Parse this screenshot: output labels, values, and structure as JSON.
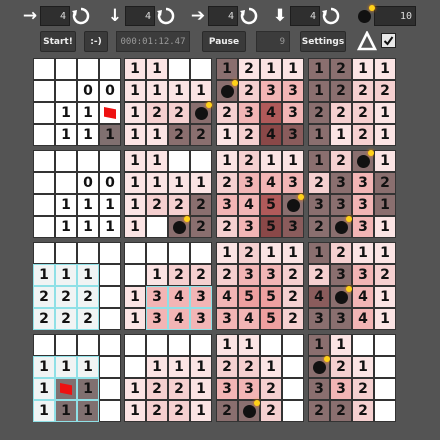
{
  "toolbar": {
    "controls": [
      {
        "arrow": "→",
        "arrow_icon": "arrow-right-icon",
        "value": "4"
      },
      {
        "arrow": "↓",
        "arrow_icon": "arrow-down-icon",
        "value": "4"
      },
      {
        "arrow": "➔",
        "arrow_icon": "bold-arrow-right-icon",
        "value": "4"
      },
      {
        "arrow": "⬇",
        "arrow_icon": "bold-arrow-down-icon",
        "value": "4"
      }
    ],
    "bomb_count": "10",
    "start_label": "Start!",
    "face_label": ":-)",
    "timer": "000:01:12.47",
    "pause_label": "Pause",
    "flags_left": "9",
    "settings_label": "Settings",
    "delta_label": "Δ",
    "checkbox_checked": true
  },
  "colors": {
    "bg": "#545454",
    "flag": "#ee1111",
    "highlight": "#8fe0e6"
  },
  "boards": [
    {
      "id": "0-0",
      "cells": [
        [
          "",
          "",
          "",
          ""
        ],
        [
          "",
          "",
          "0",
          "0"
        ],
        [
          "",
          "1",
          "1",
          "F"
        ],
        [
          "",
          "1",
          "1",
          "1"
        ]
      ],
      "shades": [
        [
          "#ffffff",
          "#ffffff",
          "#ffffff",
          "#ffffff"
        ],
        [
          "#ffffff",
          "#ffffff",
          "#ffffff",
          "#ffffff"
        ],
        [
          "#ffffff",
          "#ffffff",
          "#ffffff",
          "#ffffff"
        ],
        [
          "#ffffff",
          "#ffffff",
          "#ffffff",
          "#807070"
        ]
      ]
    },
    {
      "id": "0-1",
      "cells": [
        [
          "1",
          "1",
          "",
          ""
        ],
        [
          "1",
          "1",
          "1",
          "1"
        ],
        [
          "1",
          "2",
          "2",
          "B"
        ],
        [
          "1",
          "1",
          "2",
          "2"
        ]
      ],
      "shades": [
        [
          "#fbe4e4",
          "#fbe4e4",
          "#ffffff",
          "#ffffff"
        ],
        [
          "#fbe4e4",
          "#fbe4e4",
          "#fbe4e4",
          "#fbe4e4"
        ],
        [
          "#fbe4e4",
          "#f5d0d0",
          "#f5d0d0",
          "#8a6f6f"
        ],
        [
          "#fbe4e4",
          "#fbe4e4",
          "#8a6f6f",
          "#8a6f6f"
        ]
      ]
    },
    {
      "id": "0-2",
      "cells": [
        [
          "1",
          "2",
          "1",
          "1"
        ],
        [
          "B",
          "2",
          "3",
          "3"
        ],
        [
          "2",
          "3",
          "4",
          "3"
        ],
        [
          "1",
          "2",
          "4",
          "3"
        ]
      ],
      "shades": [
        [
          "#8a6f6f",
          "#fbe4e4",
          "#fbe4e4",
          "#fbe4e4"
        ],
        [
          "#8a6f6f",
          "#f5d0d0",
          "#f2b5b5",
          "#f2b5b5"
        ],
        [
          "#f5d0d0",
          "#f2b5b5",
          "#b05a5a",
          "#f2b5b5"
        ],
        [
          "#fbe4e4",
          "#f5d0d0",
          "#8a4848",
          "#8a5c5c"
        ]
      ]
    },
    {
      "id": "0-3",
      "cells": [
        [
          "1",
          "2",
          "1",
          "1"
        ],
        [
          "1",
          "2",
          "2",
          "2"
        ],
        [
          "2",
          "2",
          "2",
          "1"
        ],
        [
          "1",
          "1",
          "2",
          "1"
        ]
      ],
      "shades": [
        [
          "#8a6f6f",
          "#8a6f6f",
          "#fbe4e4",
          "#fbe4e4"
        ],
        [
          "#8a6f6f",
          "#8a6f6f",
          "#f5d0d0",
          "#f5d0d0"
        ],
        [
          "#8a6f6f",
          "#f5d0d0",
          "#f5d0d0",
          "#fbe4e4"
        ],
        [
          "#8a6f6f",
          "#fbe4e4",
          "#f5d0d0",
          "#fbe4e4"
        ]
      ]
    },
    {
      "id": "1-0",
      "cells": [
        [
          "",
          "",
          "",
          ""
        ],
        [
          "",
          "",
          "0",
          "0"
        ],
        [
          "",
          "1",
          "1",
          "1"
        ],
        [
          "",
          "1",
          "1",
          "1"
        ]
      ],
      "shades": [
        [
          "#ffffff",
          "#ffffff",
          "#ffffff",
          "#ffffff"
        ],
        [
          "#ffffff",
          "#ffffff",
          "#ffffff",
          "#ffffff"
        ],
        [
          "#ffffff",
          "#ffffff",
          "#ffffff",
          "#ffffff"
        ],
        [
          "#ffffff",
          "#ffffff",
          "#ffffff",
          "#ffffff"
        ]
      ]
    },
    {
      "id": "1-1",
      "cells": [
        [
          "1",
          "1",
          "",
          ""
        ],
        [
          "1",
          "1",
          "1",
          "1"
        ],
        [
          "1",
          "2",
          "2",
          "2"
        ],
        [
          "1",
          "",
          "B",
          "2"
        ]
      ],
      "shades": [
        [
          "#fbe4e4",
          "#fbe4e4",
          "#ffffff",
          "#ffffff"
        ],
        [
          "#fbe4e4",
          "#fbe4e4",
          "#fbe4e4",
          "#fbe4e4"
        ],
        [
          "#fbe4e4",
          "#f5d0d0",
          "#f5d0d0",
          "#8a6f6f"
        ],
        [
          "#fbe4e4",
          "#ffffff",
          "#8a6f6f",
          "#8a6f6f"
        ]
      ]
    },
    {
      "id": "1-2",
      "cells": [
        [
          "1",
          "2",
          "1",
          "1"
        ],
        [
          "2",
          "3",
          "4",
          "3"
        ],
        [
          "3",
          "4",
          "5",
          "B"
        ],
        [
          "2",
          "3",
          "5",
          "3"
        ]
      ],
      "shades": [
        [
          "#fbe4e4",
          "#f5d0d0",
          "#fbe4e4",
          "#fbe4e4"
        ],
        [
          "#f5d0d0",
          "#f2b5b5",
          "#f2b5b5",
          "#f2b5b5"
        ],
        [
          "#f2b5b5",
          "#f2b5b5",
          "#b05a5a",
          "#8a6f6f"
        ],
        [
          "#f5d0d0",
          "#f2b5b5",
          "#8a4848",
          "#8a5c5c"
        ]
      ]
    },
    {
      "id": "1-3",
      "cells": [
        [
          "1",
          "2",
          "B",
          "1"
        ],
        [
          "2",
          "3",
          "3",
          "2"
        ],
        [
          "3",
          "3",
          "3",
          "1"
        ],
        [
          "2",
          "B",
          "3",
          "1"
        ]
      ],
      "shades": [
        [
          "#8a6f6f",
          "#f5d0d0",
          "#8a6f6f",
          "#fbe4e4"
        ],
        [
          "#f5d0d0",
          "#8a6f6f",
          "#f2b5b5",
          "#8a6f6f"
        ],
        [
          "#8a6f6f",
          "#8a6f6f",
          "#f2b5b5",
          "#8a6f6f"
        ],
        [
          "#8a6f6f",
          "#8a6f6f",
          "#f2b5b5",
          "#fbe4e4"
        ]
      ]
    },
    {
      "id": "2-0",
      "cells": [
        [
          "",
          "",
          "",
          ""
        ],
        [
          "1",
          "1",
          "1",
          ""
        ],
        [
          "2",
          "2",
          "2",
          ""
        ],
        [
          "2",
          "2",
          "2",
          ""
        ]
      ],
      "shades": [
        [
          "#ffffff",
          "#ffffff",
          "#ffffff",
          "#ffffff"
        ],
        [
          "#f0f4f4",
          "#f0f4f4",
          "#f0f4f4",
          "#ffffff"
        ],
        [
          "#f0f4f4",
          "#f0f4f4",
          "#f0f4f4",
          "#ffffff"
        ],
        [
          "#f0f4f4",
          "#f0f4f4",
          "#f0f4f4",
          "#ffffff"
        ]
      ],
      "highlight": [
        [
          1,
          0
        ],
        [
          1,
          1
        ],
        [
          1,
          2
        ],
        [
          2,
          0
        ],
        [
          2,
          1
        ],
        [
          2,
          2
        ],
        [
          3,
          0
        ],
        [
          3,
          1
        ],
        [
          3,
          2
        ]
      ]
    },
    {
      "id": "2-1",
      "cells": [
        [
          "",
          "",
          "",
          ""
        ],
        [
          "",
          "1",
          "2",
          "2"
        ],
        [
          "1",
          "3",
          "4",
          "3"
        ],
        [
          "1",
          "3",
          "4",
          "3"
        ]
      ],
      "shades": [
        [
          "#ffffff",
          "#ffffff",
          "#ffffff",
          "#ffffff"
        ],
        [
          "#ffffff",
          "#fbe4e4",
          "#f5d0d0",
          "#f5d0d0"
        ],
        [
          "#fbe4e4",
          "#f2b5b5",
          "#f2b5b5",
          "#f2b5b5"
        ],
        [
          "#fbe4e4",
          "#f2b5b5",
          "#f2b5b5",
          "#f2b5b5"
        ]
      ],
      "highlight": [
        [
          2,
          1
        ],
        [
          2,
          2
        ],
        [
          2,
          3
        ],
        [
          3,
          1
        ],
        [
          3,
          2
        ],
        [
          3,
          3
        ]
      ]
    },
    {
      "id": "2-2",
      "cells": [
        [
          "1",
          "2",
          "1",
          "1"
        ],
        [
          "2",
          "3",
          "3",
          "2"
        ],
        [
          "4",
          "5",
          "5",
          "2"
        ],
        [
          "3",
          "4",
          "5",
          "2"
        ]
      ],
      "shades": [
        [
          "#fbe4e4",
          "#f5d0d0",
          "#fbe4e4",
          "#fbe4e4"
        ],
        [
          "#f5d0d0",
          "#f2b5b5",
          "#f2b5b5",
          "#f5d0d0"
        ],
        [
          "#f2b5b5",
          "#eea0a0",
          "#eea0a0",
          "#f5d0d0"
        ],
        [
          "#f2b5b5",
          "#f2b5b5",
          "#eea0a0",
          "#f5d0d0"
        ]
      ]
    },
    {
      "id": "2-3",
      "cells": [
        [
          "1",
          "2",
          "1",
          "1"
        ],
        [
          "2",
          "3",
          "3",
          "2"
        ],
        [
          "4",
          "B",
          "4",
          "1"
        ],
        [
          "3",
          "3",
          "4",
          "1"
        ]
      ],
      "shades": [
        [
          "#8a6f6f",
          "#f5d0d0",
          "#fbe4e4",
          "#fbe4e4"
        ],
        [
          "#f5d0d0",
          "#8a6f6f",
          "#f2b5b5",
          "#f5d0d0"
        ],
        [
          "#8a5c5c",
          "#8a6f6f",
          "#f2b5b5",
          "#fbe4e4"
        ],
        [
          "#8a6f6f",
          "#8a6f6f",
          "#f2b5b5",
          "#fbe4e4"
        ]
      ]
    },
    {
      "id": "3-0",
      "cells": [
        [
          "",
          "",
          "",
          ""
        ],
        [
          "1",
          "1",
          "1",
          ""
        ],
        [
          "1",
          "F",
          "1",
          ""
        ],
        [
          "1",
          "1",
          "1",
          ""
        ]
      ],
      "shades": [
        [
          "#ffffff",
          "#ffffff",
          "#ffffff",
          "#ffffff"
        ],
        [
          "#f0f4f4",
          "#f0f4f4",
          "#f0f4f4",
          "#ffffff"
        ],
        [
          "#f0f4f4",
          "#807070",
          "#807070",
          "#ffffff"
        ],
        [
          "#f0f4f4",
          "#807070",
          "#807070",
          "#ffffff"
        ]
      ],
      "highlight": [
        [
          1,
          0
        ],
        [
          1,
          1
        ],
        [
          1,
          2
        ],
        [
          2,
          0
        ],
        [
          2,
          1
        ],
        [
          2,
          2
        ],
        [
          3,
          0
        ],
        [
          3,
          1
        ],
        [
          3,
          2
        ]
      ]
    },
    {
      "id": "3-1",
      "cells": [
        [
          "",
          "",
          "",
          ""
        ],
        [
          "",
          "1",
          "1",
          "1"
        ],
        [
          "1",
          "2",
          "2",
          "1"
        ],
        [
          "1",
          "2",
          "2",
          "1"
        ]
      ],
      "shades": [
        [
          "#ffffff",
          "#ffffff",
          "#ffffff",
          "#ffffff"
        ],
        [
          "#ffffff",
          "#fbe4e4",
          "#fbe4e4",
          "#fbe4e4"
        ],
        [
          "#fbe4e4",
          "#f5d0d0",
          "#f5d0d0",
          "#fbe4e4"
        ],
        [
          "#fbe4e4",
          "#f5d0d0",
          "#f5d0d0",
          "#fbe4e4"
        ]
      ]
    },
    {
      "id": "3-2",
      "cells": [
        [
          "1",
          "1",
          "",
          ""
        ],
        [
          "2",
          "2",
          "1",
          ""
        ],
        [
          "3",
          "3",
          "2",
          ""
        ],
        [
          "2",
          "B",
          "2",
          ""
        ]
      ],
      "shades": [
        [
          "#fbe4e4",
          "#fbe4e4",
          "#ffffff",
          "#ffffff"
        ],
        [
          "#f5d0d0",
          "#f5d0d0",
          "#fbe4e4",
          "#ffffff"
        ],
        [
          "#f2b5b5",
          "#f2b5b5",
          "#f5d0d0",
          "#ffffff"
        ],
        [
          "#8a6f6f",
          "#8a6f6f",
          "#f5d0d0",
          "#ffffff"
        ]
      ]
    },
    {
      "id": "3-3",
      "cells": [
        [
          "1",
          "1",
          "",
          ""
        ],
        [
          "B",
          "2",
          "1",
          ""
        ],
        [
          "3",
          "3",
          "2",
          ""
        ],
        [
          "2",
          "2",
          "2",
          ""
        ]
      ],
      "shades": [
        [
          "#8a6f6f",
          "#fbe4e4",
          "#ffffff",
          "#ffffff"
        ],
        [
          "#8a6f6f",
          "#f5d0d0",
          "#fbe4e4",
          "#ffffff"
        ],
        [
          "#8a6f6f",
          "#f2b5b5",
          "#f5d0d0",
          "#ffffff"
        ],
        [
          "#8a6f6f",
          "#8a6f6f",
          "#f5d0d0",
          "#ffffff"
        ]
      ]
    }
  ]
}
